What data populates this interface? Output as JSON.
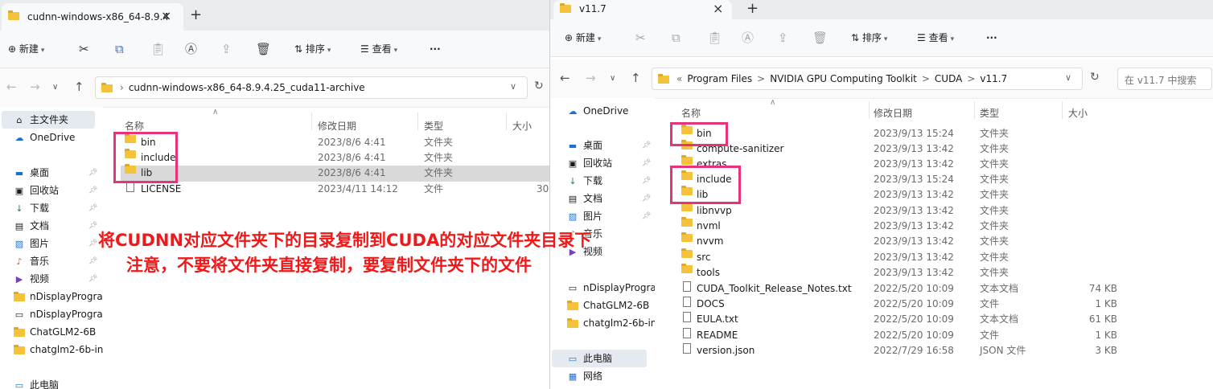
{
  "left": {
    "tab_title": "cudnn-windows-x86_64-8.9.4",
    "toolbar": {
      "new_label": "新建",
      "sort_label": "排序",
      "view_label": "查看",
      "more": "···"
    },
    "address": [
      "cudnn-windows-x86_64-8.9.4.25_cuda11-archive"
    ],
    "nav": [
      {
        "icon": "home-icon",
        "label": "主文件夹"
      },
      {
        "icon": "onedrive-icon",
        "label": "OneDrive"
      },
      {
        "icon": "desktop-icon",
        "label": "桌面"
      },
      {
        "icon": "recycle-bin-icon",
        "label": "回收站"
      },
      {
        "icon": "download-icon",
        "label": "下载"
      },
      {
        "icon": "document-icon",
        "label": "文档"
      },
      {
        "icon": "picture-icon",
        "label": "图片"
      },
      {
        "icon": "music-icon",
        "label": "音乐"
      },
      {
        "icon": "video-icon",
        "label": "视频"
      },
      {
        "icon": "folder-icon",
        "label": "nDisplayProgran"
      },
      {
        "icon": "app-icon",
        "label": "nDisplayProgran"
      },
      {
        "icon": "folder-icon",
        "label": "ChatGLM2-6B"
      },
      {
        "icon": "folder-icon",
        "label": "chatglm2-6b-int"
      },
      {
        "icon": "pc-icon",
        "label": "此电脑"
      }
    ],
    "columns": {
      "name": "名称",
      "date": "修改日期",
      "type": "类型",
      "size": "大小"
    },
    "files": [
      {
        "kind": "folder",
        "name": "bin",
        "date": "2023/8/6 4:41",
        "type": "文件夹",
        "size": ""
      },
      {
        "kind": "folder",
        "name": "include",
        "date": "2023/8/6 4:41",
        "type": "文件夹",
        "size": ""
      },
      {
        "kind": "folder",
        "name": "lib",
        "date": "2023/8/6 4:41",
        "type": "文件夹",
        "size": ""
      },
      {
        "kind": "file",
        "name": "LICENSE",
        "date": "2023/4/11 14:12",
        "type": "文件",
        "size": "30"
      }
    ]
  },
  "right": {
    "tab_title": "v11.7",
    "toolbar": {
      "new_label": "新建",
      "sort_label": "排序",
      "view_label": "查看",
      "more": "···"
    },
    "address": [
      "«",
      "Program Files",
      ">",
      "NVIDIA GPU Computing Toolkit",
      ">",
      "CUDA",
      ">",
      "v11.7"
    ],
    "search_placeholder": "在 v11.7 中搜索",
    "nav": [
      {
        "icon": "onedrive-icon",
        "label": "OneDrive"
      },
      {
        "icon": "desktop-icon",
        "label": "桌面"
      },
      {
        "icon": "recycle-bin-icon",
        "label": "回收站"
      },
      {
        "icon": "download-icon",
        "label": "下载"
      },
      {
        "icon": "document-icon",
        "label": "文档"
      },
      {
        "icon": "picture-icon",
        "label": "图片"
      },
      {
        "icon": "music-icon",
        "label": "音乐"
      },
      {
        "icon": "video-icon",
        "label": "视频"
      },
      {
        "icon": "app-icon",
        "label": "nDisplayProgran"
      },
      {
        "icon": "folder-icon",
        "label": "ChatGLM2-6B"
      },
      {
        "icon": "folder-icon",
        "label": "chatglm2-6b-int"
      },
      {
        "icon": "pc-icon",
        "label": "此电脑"
      },
      {
        "icon": "network-icon",
        "label": "网络"
      }
    ],
    "columns": {
      "name": "名称",
      "date": "修改日期",
      "type": "类型",
      "size": "大小"
    },
    "files": [
      {
        "kind": "folder",
        "name": "bin",
        "date": "2023/9/13 15:24",
        "type": "文件夹",
        "size": ""
      },
      {
        "kind": "folder",
        "name": "compute-sanitizer",
        "date": "2023/9/13 13:42",
        "type": "文件夹",
        "size": ""
      },
      {
        "kind": "folder",
        "name": "extras",
        "date": "2023/9/13 13:42",
        "type": "文件夹",
        "size": ""
      },
      {
        "kind": "folder",
        "name": "include",
        "date": "2023/9/13 15:24",
        "type": "文件夹",
        "size": ""
      },
      {
        "kind": "folder",
        "name": "lib",
        "date": "2023/9/13 13:42",
        "type": "文件夹",
        "size": ""
      },
      {
        "kind": "folder",
        "name": "libnvvp",
        "date": "2023/9/13 13:42",
        "type": "文件夹",
        "size": ""
      },
      {
        "kind": "folder",
        "name": "nvml",
        "date": "2023/9/13 13:42",
        "type": "文件夹",
        "size": ""
      },
      {
        "kind": "folder",
        "name": "nvvm",
        "date": "2023/9/13 13:42",
        "type": "文件夹",
        "size": ""
      },
      {
        "kind": "folder",
        "name": "src",
        "date": "2023/9/13 13:42",
        "type": "文件夹",
        "size": ""
      },
      {
        "kind": "folder",
        "name": "tools",
        "date": "2023/9/13 13:42",
        "type": "文件夹",
        "size": ""
      },
      {
        "kind": "file",
        "name": "CUDA_Toolkit_Release_Notes.txt",
        "date": "2022/5/20 10:09",
        "type": "文本文档",
        "size": "74 KB"
      },
      {
        "kind": "file",
        "name": "DOCS",
        "date": "2022/5/20 10:09",
        "type": "文件",
        "size": "1 KB"
      },
      {
        "kind": "file",
        "name": "EULA.txt",
        "date": "2022/5/20 10:09",
        "type": "文本文档",
        "size": "61 KB"
      },
      {
        "kind": "file",
        "name": "README",
        "date": "2022/5/20 10:09",
        "type": "文件",
        "size": "1 KB"
      },
      {
        "kind": "file",
        "name": "version.json",
        "date": "2022/7/29 16:58",
        "type": "JSON 文件",
        "size": "3 KB"
      }
    ]
  },
  "annotation": {
    "line1": "将CUDNN对应文件夹下的目录复制到CUDA的对应文件夹目录下",
    "line2": "注意，不要将文件夹直接复制，要复制文件夹下的文件"
  },
  "colors": {
    "highlight": "#e8327c",
    "annotation": "#f01818",
    "folder": "#f5c23c"
  }
}
